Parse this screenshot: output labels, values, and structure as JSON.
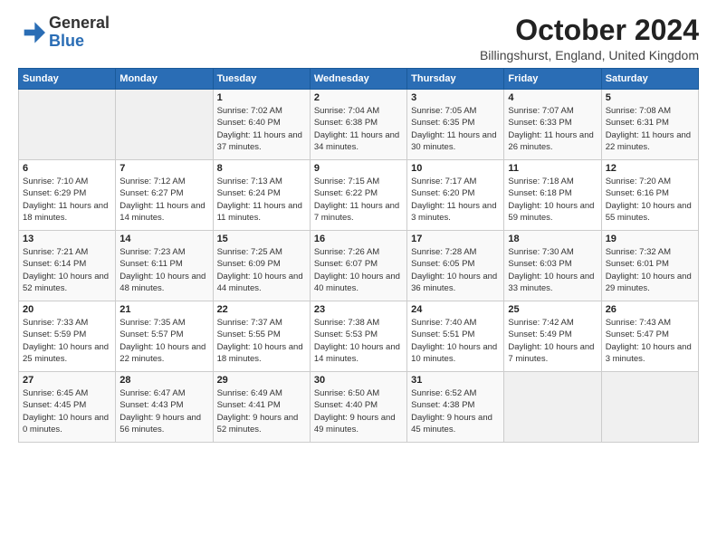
{
  "logo": {
    "general": "General",
    "blue": "Blue"
  },
  "header": {
    "month": "October 2024",
    "location": "Billingshurst, England, United Kingdom"
  },
  "weekdays": [
    "Sunday",
    "Monday",
    "Tuesday",
    "Wednesday",
    "Thursday",
    "Friday",
    "Saturday"
  ],
  "weeks": [
    [
      {
        "day": "",
        "info": ""
      },
      {
        "day": "",
        "info": ""
      },
      {
        "day": "1",
        "info": "Sunrise: 7:02 AM\nSunset: 6:40 PM\nDaylight: 11 hours and 37 minutes."
      },
      {
        "day": "2",
        "info": "Sunrise: 7:04 AM\nSunset: 6:38 PM\nDaylight: 11 hours and 34 minutes."
      },
      {
        "day": "3",
        "info": "Sunrise: 7:05 AM\nSunset: 6:35 PM\nDaylight: 11 hours and 30 minutes."
      },
      {
        "day": "4",
        "info": "Sunrise: 7:07 AM\nSunset: 6:33 PM\nDaylight: 11 hours and 26 minutes."
      },
      {
        "day": "5",
        "info": "Sunrise: 7:08 AM\nSunset: 6:31 PM\nDaylight: 11 hours and 22 minutes."
      }
    ],
    [
      {
        "day": "6",
        "info": "Sunrise: 7:10 AM\nSunset: 6:29 PM\nDaylight: 11 hours and 18 minutes."
      },
      {
        "day": "7",
        "info": "Sunrise: 7:12 AM\nSunset: 6:27 PM\nDaylight: 11 hours and 14 minutes."
      },
      {
        "day": "8",
        "info": "Sunrise: 7:13 AM\nSunset: 6:24 PM\nDaylight: 11 hours and 11 minutes."
      },
      {
        "day": "9",
        "info": "Sunrise: 7:15 AM\nSunset: 6:22 PM\nDaylight: 11 hours and 7 minutes."
      },
      {
        "day": "10",
        "info": "Sunrise: 7:17 AM\nSunset: 6:20 PM\nDaylight: 11 hours and 3 minutes."
      },
      {
        "day": "11",
        "info": "Sunrise: 7:18 AM\nSunset: 6:18 PM\nDaylight: 10 hours and 59 minutes."
      },
      {
        "day": "12",
        "info": "Sunrise: 7:20 AM\nSunset: 6:16 PM\nDaylight: 10 hours and 55 minutes."
      }
    ],
    [
      {
        "day": "13",
        "info": "Sunrise: 7:21 AM\nSunset: 6:14 PM\nDaylight: 10 hours and 52 minutes."
      },
      {
        "day": "14",
        "info": "Sunrise: 7:23 AM\nSunset: 6:11 PM\nDaylight: 10 hours and 48 minutes."
      },
      {
        "day": "15",
        "info": "Sunrise: 7:25 AM\nSunset: 6:09 PM\nDaylight: 10 hours and 44 minutes."
      },
      {
        "day": "16",
        "info": "Sunrise: 7:26 AM\nSunset: 6:07 PM\nDaylight: 10 hours and 40 minutes."
      },
      {
        "day": "17",
        "info": "Sunrise: 7:28 AM\nSunset: 6:05 PM\nDaylight: 10 hours and 36 minutes."
      },
      {
        "day": "18",
        "info": "Sunrise: 7:30 AM\nSunset: 6:03 PM\nDaylight: 10 hours and 33 minutes."
      },
      {
        "day": "19",
        "info": "Sunrise: 7:32 AM\nSunset: 6:01 PM\nDaylight: 10 hours and 29 minutes."
      }
    ],
    [
      {
        "day": "20",
        "info": "Sunrise: 7:33 AM\nSunset: 5:59 PM\nDaylight: 10 hours and 25 minutes."
      },
      {
        "day": "21",
        "info": "Sunrise: 7:35 AM\nSunset: 5:57 PM\nDaylight: 10 hours and 22 minutes."
      },
      {
        "day": "22",
        "info": "Sunrise: 7:37 AM\nSunset: 5:55 PM\nDaylight: 10 hours and 18 minutes."
      },
      {
        "day": "23",
        "info": "Sunrise: 7:38 AM\nSunset: 5:53 PM\nDaylight: 10 hours and 14 minutes."
      },
      {
        "day": "24",
        "info": "Sunrise: 7:40 AM\nSunset: 5:51 PM\nDaylight: 10 hours and 10 minutes."
      },
      {
        "day": "25",
        "info": "Sunrise: 7:42 AM\nSunset: 5:49 PM\nDaylight: 10 hours and 7 minutes."
      },
      {
        "day": "26",
        "info": "Sunrise: 7:43 AM\nSunset: 5:47 PM\nDaylight: 10 hours and 3 minutes."
      }
    ],
    [
      {
        "day": "27",
        "info": "Sunrise: 6:45 AM\nSunset: 4:45 PM\nDaylight: 10 hours and 0 minutes."
      },
      {
        "day": "28",
        "info": "Sunrise: 6:47 AM\nSunset: 4:43 PM\nDaylight: 9 hours and 56 minutes."
      },
      {
        "day": "29",
        "info": "Sunrise: 6:49 AM\nSunset: 4:41 PM\nDaylight: 9 hours and 52 minutes."
      },
      {
        "day": "30",
        "info": "Sunrise: 6:50 AM\nSunset: 4:40 PM\nDaylight: 9 hours and 49 minutes."
      },
      {
        "day": "31",
        "info": "Sunrise: 6:52 AM\nSunset: 4:38 PM\nDaylight: 9 hours and 45 minutes."
      },
      {
        "day": "",
        "info": ""
      },
      {
        "day": "",
        "info": ""
      }
    ]
  ]
}
